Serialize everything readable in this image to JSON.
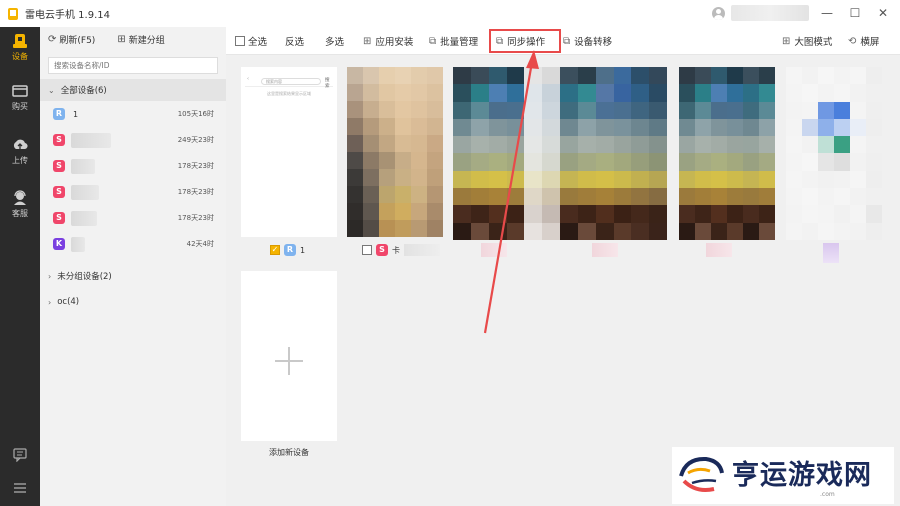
{
  "app": {
    "title": "雷电云手机 1.9.14"
  },
  "window_controls": {
    "minimize": "—",
    "maximize": "☐",
    "close": "✕"
  },
  "nav": {
    "items": [
      {
        "label": "设备",
        "icon": "device-icon",
        "active": true
      },
      {
        "label": "购买",
        "icon": "purchase-icon",
        "active": false
      },
      {
        "label": "上传",
        "icon": "upload-icon",
        "active": false
      },
      {
        "label": "客服",
        "icon": "support-icon",
        "active": false
      }
    ]
  },
  "panel": {
    "refresh_label": "刷新(F5)",
    "new_group_label": "新建分组",
    "search_placeholder": "搜索设备名称/ID",
    "groups": [
      {
        "label": "全部设备(6)",
        "expanded": true
      },
      {
        "label": "未分组设备(2)",
        "expanded": false
      },
      {
        "label": "oc(4)",
        "expanded": false
      }
    ],
    "devices": [
      {
        "badge": "R",
        "color": "#7fb3ee",
        "name": "1",
        "time": "105天16时"
      },
      {
        "badge": "S",
        "color": "#f0466a",
        "name": "",
        "time": "249天23时"
      },
      {
        "badge": "S",
        "color": "#f0466a",
        "name": "",
        "time": "178天23时"
      },
      {
        "badge": "S",
        "color": "#f0466a",
        "name": "",
        "time": "178天23时"
      },
      {
        "badge": "S",
        "color": "#f0466a",
        "name": "",
        "time": "178天23时"
      },
      {
        "badge": "K",
        "color": "#7a3fe0",
        "name": "",
        "time": "42天4时"
      }
    ]
  },
  "toolbar": {
    "select_all": "全选",
    "invert": "反选",
    "multi": "多选",
    "app_install": "应用安装",
    "batch": "批量管理",
    "sync": "同步操作",
    "transfer": "设备转移",
    "large_mode": "大图模式",
    "landscape": "横屏"
  },
  "cards": {
    "first_label": "1",
    "second_badge": "S",
    "second_label": "卡",
    "first_screen_search": "搜索内容",
    "first_screen_btn": "搜索",
    "first_screen_hint": "这里是搜索结果显示区域"
  },
  "add_device": {
    "label": "添加新设备"
  },
  "watermark": {
    "text": "亨运游戏网",
    "domain": ".com"
  },
  "colors": {
    "accent": "#f5b400",
    "highlight": "#e84a4a",
    "nav_bg": "#2b2b2b"
  }
}
